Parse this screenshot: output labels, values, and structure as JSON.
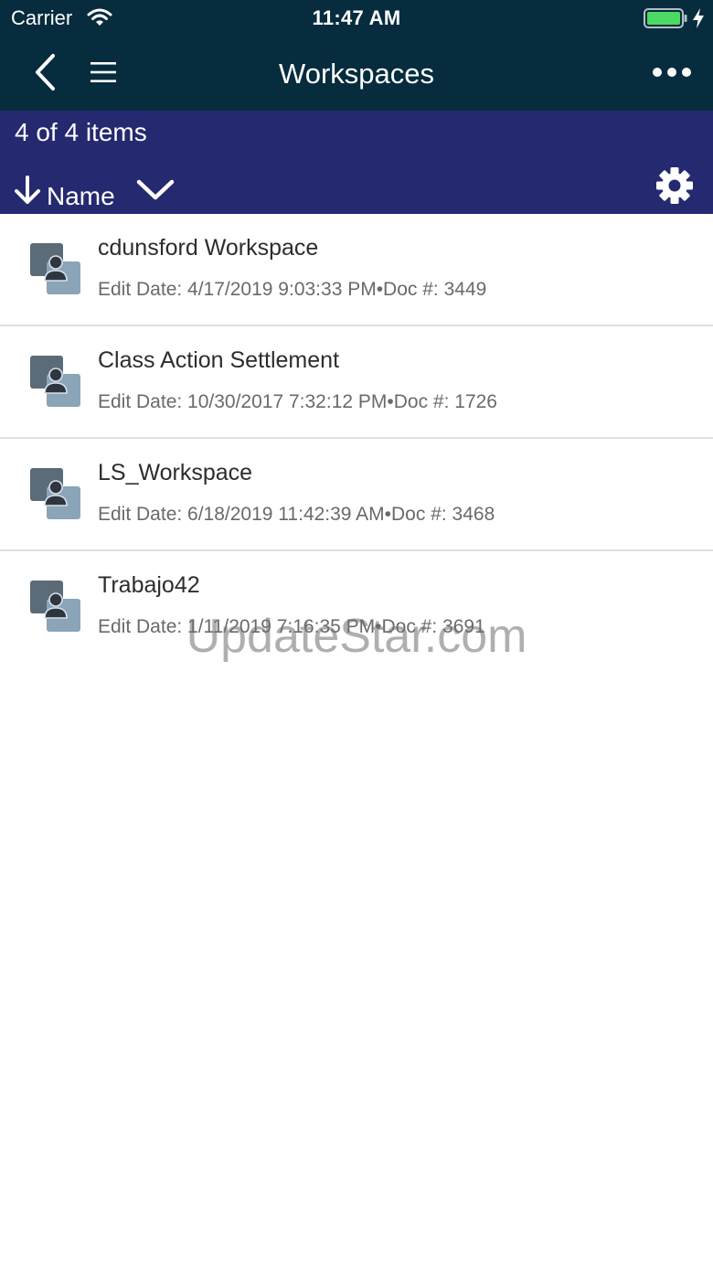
{
  "status_bar": {
    "carrier": "Carrier",
    "time": "11:47 AM"
  },
  "nav": {
    "title": "Workspaces",
    "icons": [
      "back-icon",
      "menu-icon",
      "more-icon"
    ]
  },
  "toolbar": {
    "count_text": "4 of 4 items",
    "sort_label": "Name",
    "icons": [
      "arrow-down-icon",
      "chevron-down-icon",
      "gear-icon"
    ]
  },
  "workspaces": [
    {
      "name": "cdunsford Workspace",
      "meta": "Edit Date: 4/17/2019 9:03:33 PM•Doc #: 3449"
    },
    {
      "name": "Class Action Settlement",
      "meta": "Edit Date: 10/30/2017 7:32:12 PM•Doc #: 1726"
    },
    {
      "name": "LS_Workspace",
      "meta": "Edit Date: 6/18/2019 11:42:39 AM•Doc #: 3468"
    },
    {
      "name": "Trabajo42",
      "meta": "Edit Date: 1/11/2019 7:16:35 PM•Doc #: 3691"
    }
  ],
  "watermark": "UpdateStar.com",
  "colors": {
    "nav_background": "#062c3e",
    "toolbar_background": "#25296f",
    "battery_fill": "#4cd964",
    "icon_back_square": "#5b6b78",
    "icon_front_square": "#8aa4b8"
  }
}
